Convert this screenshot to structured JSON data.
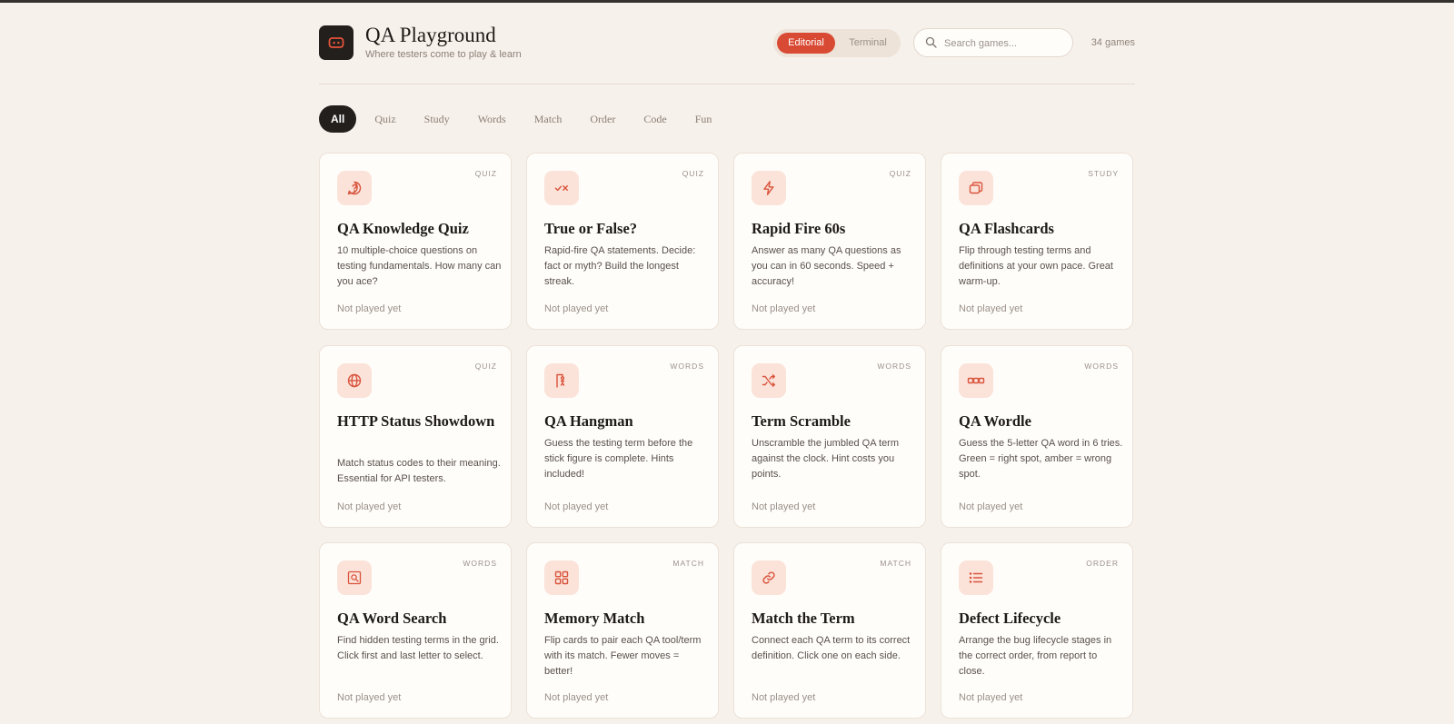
{
  "header": {
    "title": "QA Playground",
    "subtitle": "Where testers come to play & learn",
    "modes": [
      "Editorial",
      "Terminal"
    ],
    "active_mode": "Editorial",
    "search_placeholder": "Search games...",
    "count": "34 games"
  },
  "filters": [
    "All",
    "Quiz",
    "Study",
    "Words",
    "Match",
    "Order",
    "Code",
    "Fun"
  ],
  "active_filter": "All",
  "colors": {
    "accent": "#d94a34",
    "icon_bg": "#fbe3d9",
    "dark": "#231f1c",
    "page_bg": "#f7f1eb"
  },
  "cards": [
    {
      "category": "QUIZ",
      "title": "QA Knowledge Quiz",
      "description": "10 multiple-choice questions on testing fundamentals. How many can you ace?",
      "status": "Not played yet",
      "icon": "question-bubble-icon"
    },
    {
      "category": "QUIZ",
      "title": "True or False?",
      "description": "Rapid-fire QA statements. Decide: fact or myth? Build the longest streak.",
      "status": "Not played yet",
      "icon": "check-cross-icon"
    },
    {
      "category": "QUIZ",
      "title": "Rapid Fire 60s",
      "description": "Answer as many QA questions as you can in 60 seconds. Speed + accuracy!",
      "status": "Not played yet",
      "icon": "lightning-icon"
    },
    {
      "category": "STUDY",
      "title": "QA Flashcards",
      "description": "Flip through testing terms and definitions at your own pace. Great warm-up.",
      "status": "Not played yet",
      "icon": "flashcards-icon"
    },
    {
      "category": "QUIZ",
      "title": "HTTP Status Showdown",
      "description": "Match status codes to their meaning. Essential for API testers.",
      "status": "Not played yet",
      "icon": "globe-icon"
    },
    {
      "category": "WORDS",
      "title": "QA Hangman",
      "description": "Guess the testing term before the stick figure is complete. Hints included!",
      "status": "Not played yet",
      "icon": "gallows-icon"
    },
    {
      "category": "WORDS",
      "title": "Term Scramble",
      "description": "Unscramble the jumbled QA term against the clock. Hint costs you points.",
      "status": "Not played yet",
      "icon": "shuffle-icon"
    },
    {
      "category": "WORDS",
      "title": "QA Wordle",
      "description": "Guess the 5-letter QA word in 6 tries. Green = right spot, amber = wrong spot.",
      "status": "Not played yet",
      "icon": "letter-tiles-icon"
    },
    {
      "category": "WORDS",
      "title": "QA Word Search",
      "description": "Find hidden testing terms in the grid. Click first and last letter to select.",
      "status": "Not played yet",
      "icon": "grid-search-icon"
    },
    {
      "category": "MATCH",
      "title": "Memory Match",
      "description": "Flip cards to pair each QA tool/term with its match. Fewer moves = better!",
      "status": "Not played yet",
      "icon": "four-squares-icon"
    },
    {
      "category": "MATCH",
      "title": "Match the Term",
      "description": "Connect each QA term to its correct definition. Click one on each side.",
      "status": "Not played yet",
      "icon": "link-icon"
    },
    {
      "category": "ORDER",
      "title": "Defect Lifecycle",
      "description": "Arrange the bug lifecycle stages in the correct order, from report to close.",
      "status": "Not played yet",
      "icon": "ordered-list-icon"
    }
  ]
}
